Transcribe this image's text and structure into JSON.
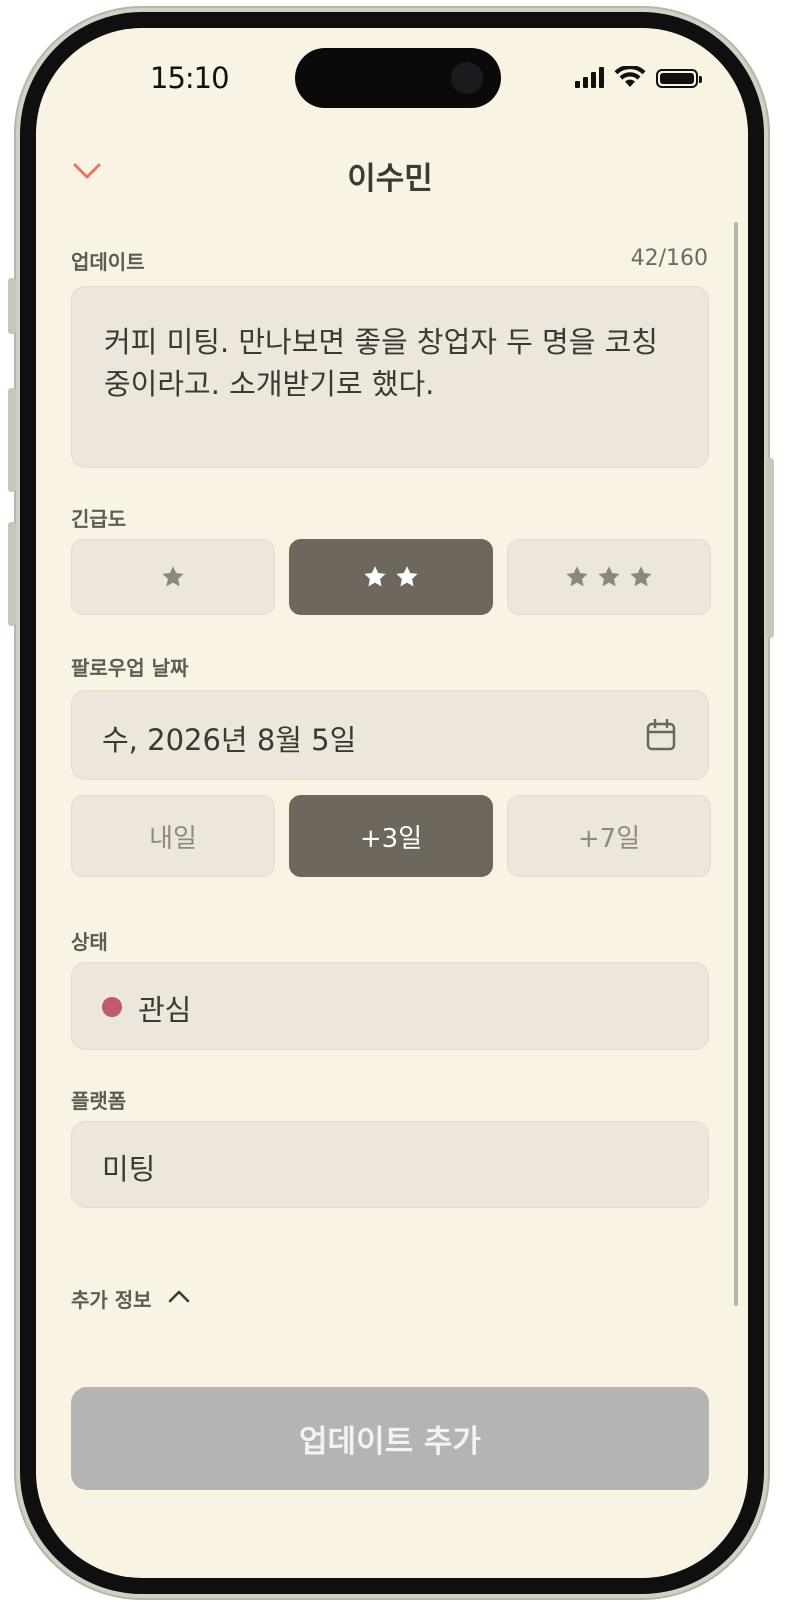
{
  "status_bar": {
    "time": "15:10"
  },
  "header": {
    "title": "이수민"
  },
  "update": {
    "label": "업데이트",
    "counter": "42/160",
    "text": "커피 미팅. 만나보면 좋을 창업자 두 명을 코칭 중이라고. 소개받기로 했다."
  },
  "urgency": {
    "label": "긴급도",
    "options": [
      {
        "stars": 1,
        "selected": false
      },
      {
        "stars": 2,
        "selected": true
      },
      {
        "stars": 3,
        "selected": false
      }
    ]
  },
  "followup": {
    "label": "팔로우업 날짜",
    "date": "수, 2026년 8월 5일",
    "quick_options": [
      "내일",
      "+3일",
      "+7일"
    ],
    "selected_index": 1
  },
  "status": {
    "label": "상태",
    "value": "관심",
    "dot_color": "#c05a6b"
  },
  "platform": {
    "label": "플랫폼",
    "value": "미팅"
  },
  "extra": {
    "label": "추가 정보"
  },
  "submit": {
    "label": "업데이트 추가"
  },
  "colors": {
    "background": "#f9f3e4",
    "field": "#ede6dc",
    "selected": "#6e675d",
    "accent": "#e07a5f",
    "submit_disabled": "#b4b4b4"
  }
}
